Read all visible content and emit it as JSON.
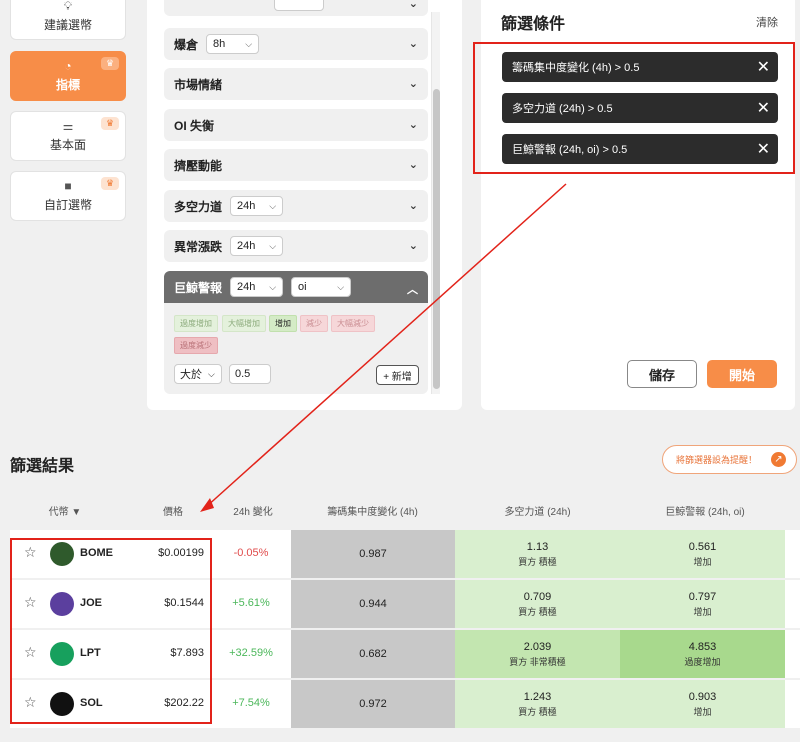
{
  "nav": {
    "items": [
      {
        "label": "建議選幣",
        "icon": "lightbulb-icon"
      },
      {
        "label": "指標",
        "icon": "indicator-icon"
      },
      {
        "label": "基本面",
        "icon": "sliders-icon"
      },
      {
        "label": "自訂選幣",
        "icon": "briefcase-icon"
      }
    ],
    "crown_icon": "crown-icon"
  },
  "indicators": {
    "sections": [
      {
        "label": "爆倉",
        "select": "8h"
      },
      {
        "label": "市場情緒"
      },
      {
        "label": "OI 失衡"
      },
      {
        "label": "擠壓動能"
      },
      {
        "label": "多空力道",
        "select": "24h"
      },
      {
        "label": "異常漲跌",
        "select": "24h"
      },
      {
        "label": "巨鯨警報",
        "select": "24h",
        "select2": "oi"
      }
    ],
    "chips": [
      "過度增加",
      "大幅增加",
      "增加",
      "減少",
      "大幅減少",
      "過度減少"
    ],
    "compare_select": "大於",
    "compare_value": "0.5",
    "add_label": "+ 新增"
  },
  "filters": {
    "title": "篩選條件",
    "clear_label": "清除",
    "tags": [
      "籌碼集中度變化 (4h) > 0.5",
      "多空力道 (24h) > 0.5",
      "巨鯨警報 (24h, oi) > 0.5"
    ],
    "save_label": "儲存",
    "start_label": "開始"
  },
  "results": {
    "title": "篩選結果",
    "alert_label": "將篩選器設為提醒！",
    "headers": [
      "代幣 ▼",
      "價格",
      "24h 變化",
      "籌碼集中度變化 (4h)",
      "多空力道 (24h)",
      "巨鯨警報 (24h, oi)"
    ],
    "rows": [
      {
        "symbol": "BOME",
        "price": "$0.00199",
        "change": "-0.05%",
        "chip": "0.987",
        "ls_val": "1.13",
        "ls_lab": "買方 積極",
        "wh_val": "0.561",
        "wh_lab": "增加"
      },
      {
        "symbol": "JOE",
        "price": "$0.1544",
        "change": "+5.61%",
        "chip": "0.944",
        "ls_val": "0.709",
        "ls_lab": "買方 積極",
        "wh_val": "0.797",
        "wh_lab": "增加"
      },
      {
        "symbol": "LPT",
        "price": "$7.893",
        "change": "+32.59%",
        "chip": "0.682",
        "ls_val": "2.039",
        "ls_lab": "買方 非常積極",
        "wh_val": "4.853",
        "wh_lab": "過度增加"
      },
      {
        "symbol": "SOL",
        "price": "$202.22",
        "change": "+7.54%",
        "chip": "0.972",
        "ls_val": "1.243",
        "ls_lab": "買方 積極",
        "wh_val": "0.903",
        "wh_lab": "增加"
      }
    ]
  },
  "colors": {
    "accent": "#f78d48",
    "annotation_red": "#e2231a",
    "chip_gray": "#c8c8c8",
    "green_light": "#d9efcf",
    "green_strong": "#b3de9c"
  }
}
